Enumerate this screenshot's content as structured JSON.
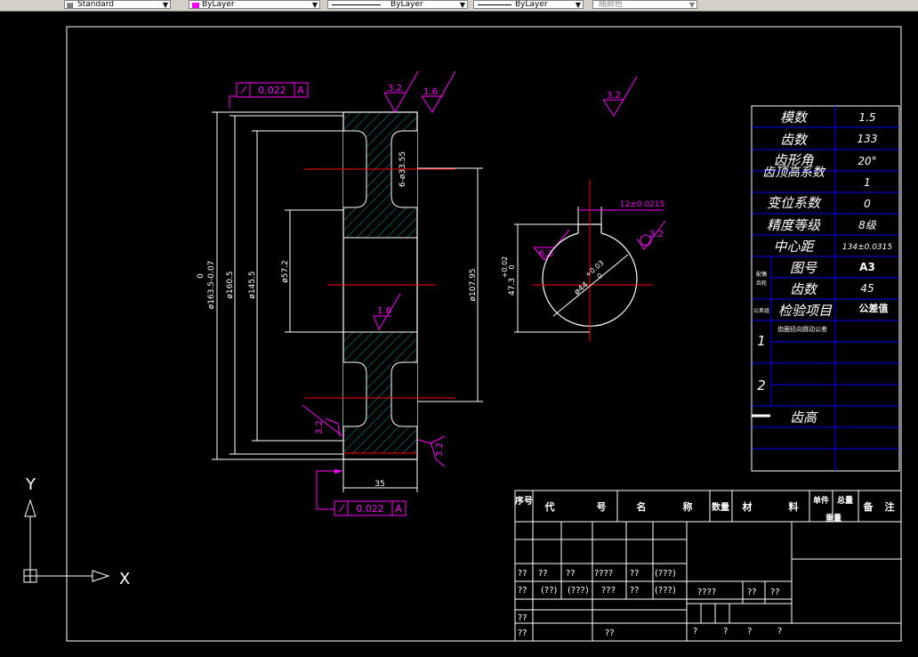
{
  "toolbar": {
    "text_style": "Standard",
    "color": "ByLayer",
    "linetype": "ByLayer",
    "lineweight": "ByLayer",
    "plot_style": "随颜色",
    "color_swatch": "#ff00ff"
  },
  "ucs": {
    "x_label": "X",
    "y_label": "Y"
  },
  "dims": {
    "tol_top": "0.022",
    "tol_top_ref": "A",
    "tol_bottom": "0.022",
    "tol_bottom_ref": "A",
    "rough_top1": "3.2",
    "rough_top2": "1.6",
    "rough_mid": "1.6",
    "rough_left": "3.2",
    "rough_right": "3.2",
    "rough_global": "3.2",
    "d_outer": "ø163.5-0.07",
    "d_outer_up": "0",
    "d_160": "ø160.5",
    "d_145": "ø145.5",
    "d_57": "ø57.2",
    "d_107": "ø107.95",
    "holes": "6-ø33.55",
    "width": "35",
    "key_width": "12±0.0215",
    "key_depth": "47.3",
    "key_depth_tol_up": "+0.02",
    "key_depth_tol_low": "0",
    "bore": "ø44",
    "bore_tol_up": "+0.03",
    "bore_tol_low": "0",
    "rough_key": "6.3",
    "rough_key2": "3.2"
  },
  "param_table": {
    "rows": [
      {
        "label": "模数",
        "value": "1.5"
      },
      {
        "label": "齿数",
        "value": "133"
      },
      {
        "label": "齿形角",
        "value": "20°"
      },
      {
        "label": "齿顶高系数",
        "value": "1"
      },
      {
        "label": "变位系数",
        "value": "0"
      },
      {
        "label": "精度等级",
        "value": "8级"
      },
      {
        "label": "中心距",
        "value": "134±0.0315"
      },
      {
        "label": "图号",
        "value": "A3"
      },
      {
        "label": "齿数",
        "value": "45"
      },
      {
        "label": "检验项目",
        "value": "公差值"
      }
    ],
    "side_label1": "配偶",
    "side_label2": "齿轮",
    "side_label3": "公差组",
    "item1_no": "1",
    "item1_text": "齿圈径向跳动公差",
    "item2_no": "2",
    "tooth_height": "齿高"
  },
  "title_block": {
    "header": [
      "序号",
      "代",
      "号",
      "名",
      "称",
      "数量",
      "材",
      "料",
      "单件",
      "总量",
      "备",
      "注"
    ],
    "header_extra": "重量",
    "r1": [
      "??",
      "??",
      "??",
      "????",
      "??",
      "(???)"
    ],
    "r2": [
      "??",
      "(??)",
      "(???)",
      "???",
      "??",
      "(???)"
    ],
    "r2_right": [
      "????",
      "??",
      "??"
    ],
    "r3": [
      "??"
    ],
    "r4": [
      "??",
      "??"
    ],
    "r4_right": [
      "?",
      "?",
      "?",
      "?"
    ]
  }
}
